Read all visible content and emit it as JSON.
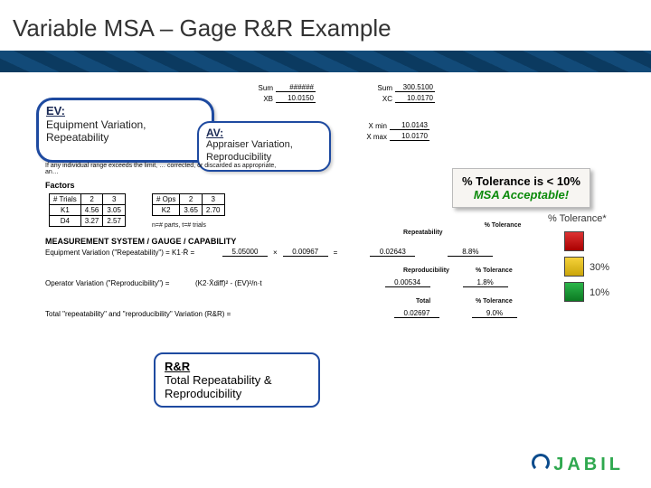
{
  "chart_data": {
    "type": "table",
    "title": "Variable MSA – Gage R&R Example",
    "sums": {
      "sum_left": "######",
      "XB": "10.0150",
      "sum_right": "300.5100",
      "XC": "10.0170"
    },
    "readback": {
      "x_min": "10.0143",
      "x_max": "10.0170"
    },
    "factors": {
      "trials": [
        "2",
        "3"
      ],
      "K1": [
        "4.56",
        "3.05"
      ],
      "D4": [
        "3.27",
        "2.57"
      ],
      "ops": [
        "2",
        "3"
      ],
      "K2": [
        "3.65",
        "2.70"
      ],
      "footnote": "n=# parts, t=# trials"
    },
    "calculations": {
      "ev_eq": "Equipment Variation (\"Repeatability\") = K1·R̄ =",
      "ev_vals": {
        "a": "5.05000",
        "b": "0.00967",
        "result": "0.02643"
      },
      "repeatability_pct": "8.8%",
      "av_eq": "Operator Variation (\"Reproducibility\") =",
      "av_formula": "(K2·X̄diff)² - (EV)²/n·t",
      "reproducibility_val": "0.00534",
      "reproducibility_pct": "1.8%",
      "rr_eq": "Total \"repeatability\" and \"reproducibility\" Variation (R&R) =",
      "rr_val": "0.02697",
      "rr_pct": "9.0%"
    },
    "legend": {
      "green_max": 10,
      "yellow_max": 30
    },
    "callouts": {
      "ev_title": "EV:",
      "ev_text": "Equipment Variation, Repeatability",
      "av_title": "AV:",
      "av_text": "Appraiser Variation, Reproducibility",
      "rnr_title": "R&R",
      "rnr_text": "Total Repeatability & Reproducibility",
      "tolerance_line": "% Tolerance is < 10%",
      "tolerance_verdict": "MSA Acceptable!"
    },
    "notes": {
      "sys_hdr": "MEASUREMENT SYSTEM / GAUGE / CAPABILITY",
      "pct_col": "% Tolerance",
      "pct_star": "% Tolerance*",
      "rep_lbl": "Repeatability",
      "reprod_lbl": "Reproducibility",
      "tot_lbl": "Total",
      "discard": "If any individual range exceeds the limit, … corrected, or discarded as appropriate, an…",
      "factors_title": "Factors",
      "brand": "JABIL"
    }
  }
}
